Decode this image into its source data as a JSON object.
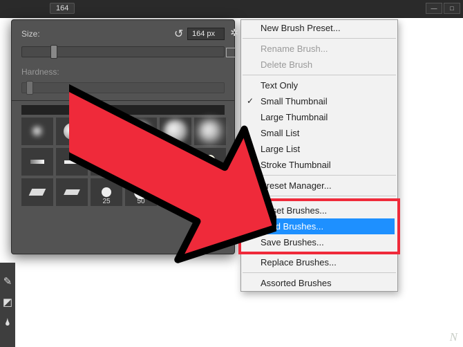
{
  "topbar": {
    "brush_size_badge": "164"
  },
  "panel": {
    "size_label": "Size:",
    "size_value": "164 px",
    "hardness_label": "Hardness:",
    "brush_numbers": [
      "25",
      "50"
    ]
  },
  "menu": {
    "new_preset": "New Brush Preset...",
    "rename": "Rename Brush...",
    "delete": "Delete Brush",
    "text_only": "Text Only",
    "small_thumb": "Small Thumbnail",
    "large_thumb": "Large Thumbnail",
    "small_list": "Small List",
    "large_list": "Large List",
    "stroke_thumb": "Stroke Thumbnail",
    "preset_mgr": "Preset Manager...",
    "reset": "Reset Brushes...",
    "load": "Load Brushes...",
    "save": "Save Brushes...",
    "replace": "Replace Brushes...",
    "assorted": "Assorted Brushes"
  },
  "watermark": "N"
}
